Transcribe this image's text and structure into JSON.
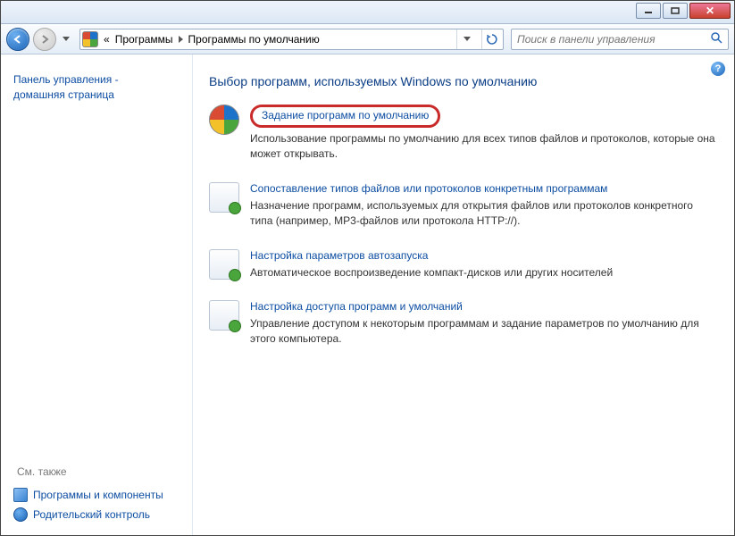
{
  "breadcrumb": {
    "prefix": "«",
    "first": "Программы",
    "second": "Программы по умолчанию"
  },
  "search": {
    "placeholder": "Поиск в панели управления"
  },
  "sidebar": {
    "heading1": "Панель управления -",
    "heading2": "домашняя страница",
    "see_also": "См. также",
    "link_programs": "Программы и компоненты",
    "link_parental": "Родительский контроль"
  },
  "main": {
    "heading": "Выбор программ, используемых Windows по умолчанию",
    "items": [
      {
        "title": "Задание программ по умолчанию",
        "desc": "Использование программы по умолчанию для всех типов файлов и протоколов, которые она может открывать."
      },
      {
        "title": "Сопоставление типов файлов или протоколов конкретным программам",
        "desc": "Назначение программ, используемых для открытия файлов или протоколов конкретного типа (например, MP3-файлов  или протокола HTTP://)."
      },
      {
        "title": "Настройка параметров автозапуска",
        "desc": "Автоматическое воспроизведение компакт-дисков или других носителей"
      },
      {
        "title": "Настройка доступа программ и умолчаний",
        "desc": "Управление доступом к некоторым программам и задание параметров по умолчанию для этого компьютера."
      }
    ]
  },
  "help": "?"
}
